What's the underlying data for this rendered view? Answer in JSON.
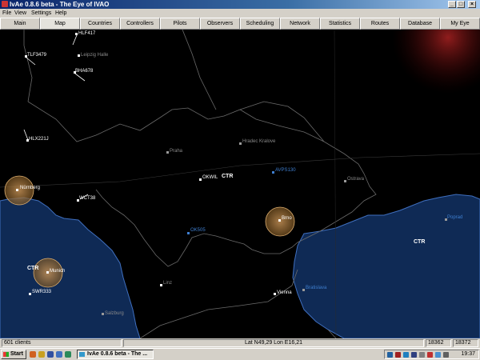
{
  "window": {
    "title": "IvAe 0.8.6 beta - The Eye of IVAO",
    "buttons": {
      "minimize": "_",
      "maximize": "□",
      "close": "×"
    }
  },
  "menu": [
    "File",
    "View",
    "Settings",
    "Help"
  ],
  "tabs": [
    "Main",
    "Map",
    "Countries",
    "Controllers",
    "Pilots",
    "Observers",
    "Scheduling",
    "Network",
    "Statistics",
    "Routes",
    "Database",
    "My Eye"
  ],
  "active_tab": "Map",
  "map": {
    "colors": {
      "background": "#000000",
      "sector_fill": "#0f2a55",
      "sector_stroke": "#3f6fbf",
      "border": "#7a7a7a",
      "atc_circle": "#a07840",
      "pilot": "#ffffff",
      "selected": "#3f7fd0"
    },
    "aircraft": {
      "hlf417": "HLF417",
      "tlf3479": "TLF3479",
      "bha678": "BHA678",
      "hlx221j": "HLX221J",
      "wct38": "WCT38",
      "okwil": "OKWIL",
      "avps130": "AVPS130",
      "okxxs": "OK505",
      "swr333": "SWR333"
    },
    "airports": {
      "leipzig": "Leipzig Halle",
      "hradec": "Hradec Kralove",
      "praha": "Praha",
      "ostrava": "Ostrava",
      "poprad": "Poprad",
      "bratislava": "Bratislava",
      "vienna": "Vienna",
      "linz": "Linz",
      "salzburg": "Salzburg",
      "nurnberg": "Nürnberg",
      "munich": "Munich",
      "brno": "Brno"
    },
    "ctr_labels": {
      "prague": "CTR",
      "slovakia": "CTR",
      "munich": "CTR"
    }
  },
  "status": {
    "clients": "601 clients",
    "position": "Lat N49,29 Lon E16,21",
    "cell1": "18362",
    "cell2": "18372"
  },
  "taskbar": {
    "start": "Start",
    "task": "IvAe 0.8.6 beta - The ...",
    "clock": "19:37"
  }
}
